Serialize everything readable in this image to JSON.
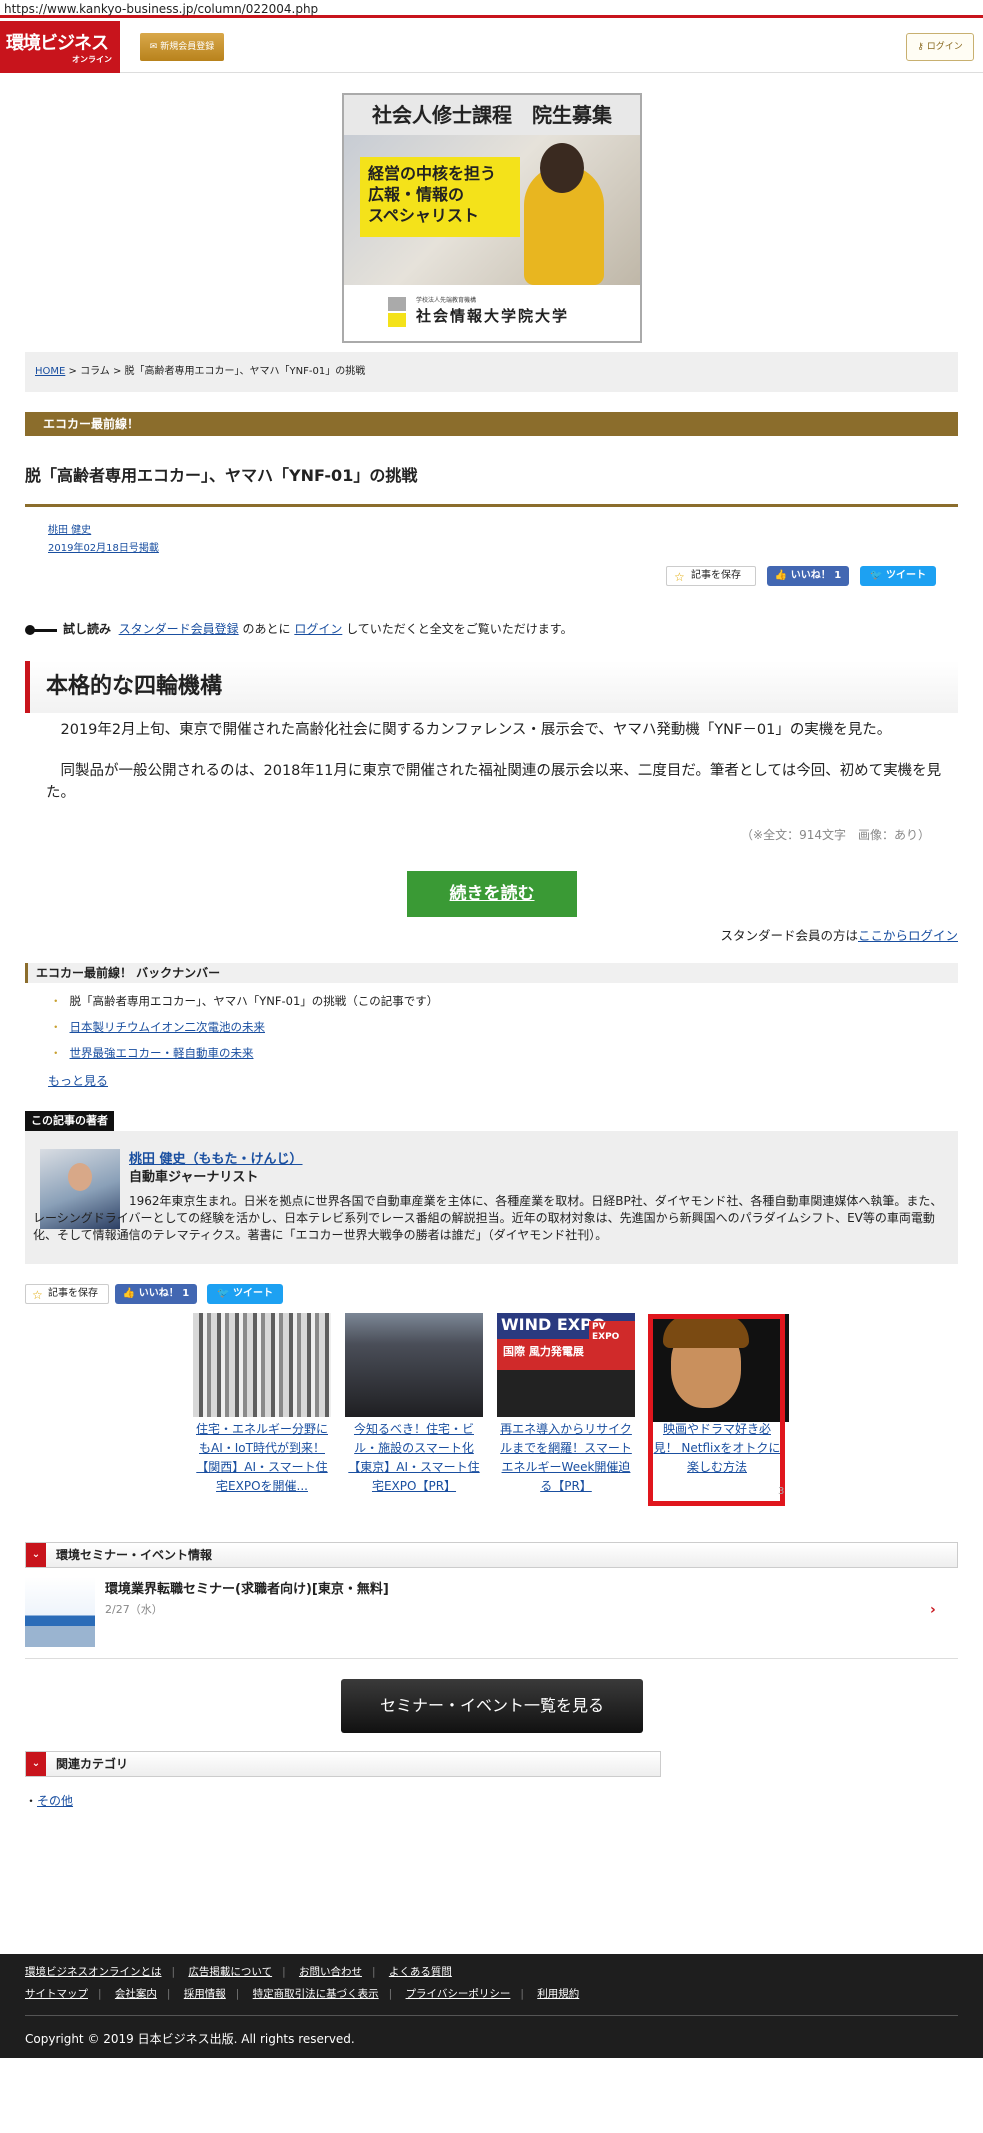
{
  "browser": {
    "url": "https://www.kankyo-business.jp/column/022004.php"
  },
  "header": {
    "logo_main": "環境ビジネス",
    "logo_sub": "オンライン",
    "register_label": "新規会員登録",
    "login_label": "ログイン"
  },
  "ad": {
    "headline": "社会人修士課程　院生募集",
    "copy_line1": "経営の中核を担う",
    "copy_line2": "広報・情報の",
    "copy_line3": "スペシャリスト",
    "school_sub": "学校法人先端教育機構",
    "school_name": "社会情報大学院大学"
  },
  "breadcrumb": {
    "home": "HOME",
    "sep1": " > ",
    "column": "コラム",
    "sep2": " > ",
    "current": "脱「高齢者専用エコカー」、ヤマハ「YNF-01」の挑戦"
  },
  "article": {
    "series": "エコカー最前線！",
    "title": "脱「高齢者専用エコカー」、ヤマハ「YNF-01」の挑戦",
    "author": "桃田 健史",
    "date": "2019年02月18日号掲載",
    "save_label": "記事を保存",
    "like_label": "いいね！ 1",
    "tweet_label": "ツイート",
    "trial_label": "試し読み",
    "trial_link1": "スタンダード会員登録",
    "trial_text1": " のあとに ",
    "trial_link2": "ログイン",
    "trial_text2": " していただくと全文をご覧いただけます。",
    "section_heading": "本格的な四輪機構",
    "para1": "2019年2月上旬、東京で開催された高齢化社会に関するカンファレンス・展示会で、ヤマハ発動機「YNF－01」の実機を見た。",
    "para2": "同製品が一般公開されるのは、2018年11月に東京で開催された福祉関連の展示会以来、二度目だ。筆者としては今回、初めて実機を見た。",
    "wordcount": "（※全文：914文字　画像：あり）",
    "read_more": "続きを読む",
    "login_prompt": "スタンダード会員の方は",
    "login_link": "ここからログイン"
  },
  "backnumber": {
    "heading": "エコカー最前線！ バックナンバー",
    "items": [
      "脱「高齢者専用エコカー」、ヤマハ「YNF-01」の挑戦（この記事です）",
      "日本製リチウムイオン二次電池の未来",
      "世界最強エコカー・軽自動車の未来"
    ],
    "more": "もっと見る"
  },
  "author_box": {
    "heading": "この記事の著者",
    "name": "桃田 健史（ももた・けんじ）",
    "role": "自動車ジャーナリスト",
    "bio": "1962年東京生まれ。日米を拠点に世界各国で自動車産業を主体に、各種産業を取材。日経BP社、ダイヤモンド社、各種自動車関連媒体へ執筆。また、レーシングドライバーとしての経験を活かし、日本テレビ系列でレース番組の解説担当。近年の取材対象は、先進国から新興国へのパラダイムシフト、EV等の車両電動化、そして情報通信のテレマティクス。著書に「エコカー世界大戦争の勝者は誰だ」（ダイヤモンド社刊）。"
  },
  "share2": {
    "save_label": "記事を保存",
    "like_label": "いいね！ 1",
    "tweet_label": "ツイート"
  },
  "cards": [
    {
      "text": "住宅・エネルギー分野にもAI・IoT時代が到来！ 【関西】AI・スマート住宅EXPOを開催..."
    },
    {
      "text": "今知るべき！住宅・ビル・施設のスマート化【東京】AI・スマート住宅EXPO【PR】"
    },
    {
      "text": "再エネ導入からリサイクルまでを網羅！スマートエネルギーWeek開催迫る【PR】"
    },
    {
      "text": "映画やドラマ好き必見！ Netflixをオトクに楽しむ方法"
    }
  ],
  "card_banner": {
    "line1": "WIND EXPO",
    "line2": "国際 風力発電展",
    "badge": "PV EXPO"
  },
  "card4_number": "3",
  "seminar": {
    "heading": "環境セミナー・イベント情報",
    "title": "環境業界転職セミナー(求職者向け)[東京・無料]",
    "date": "2/27（水）",
    "button": "セミナー・イベント一覧を見る"
  },
  "category": {
    "heading": "関連カテゴリ",
    "item": "その他"
  },
  "footer": {
    "row1": [
      "環境ビジネスオンラインとは",
      "広告掲載について",
      "お問い合わせ",
      "よくある質問"
    ],
    "row2": [
      "サイトマップ",
      "会社案内",
      "採用情報",
      "特定商取引法に基づく表示",
      "プライバシーポリシー",
      "利用規約"
    ],
    "copyright": "Copyright © 2019 日本ビジネス出版. All rights reserved."
  },
  "colors": {
    "brand_red": "#c8141c",
    "series_brown": "#8b6d2c",
    "readmore_green": "#3a9a35",
    "facebook": "#4267b2",
    "twitter": "#1da1f2"
  },
  "icons": [
    "star-icon",
    "thumbs-up-icon",
    "twitter-bird-icon",
    "key-icon",
    "chevron-right-icon",
    "chevron-down-icon"
  ]
}
